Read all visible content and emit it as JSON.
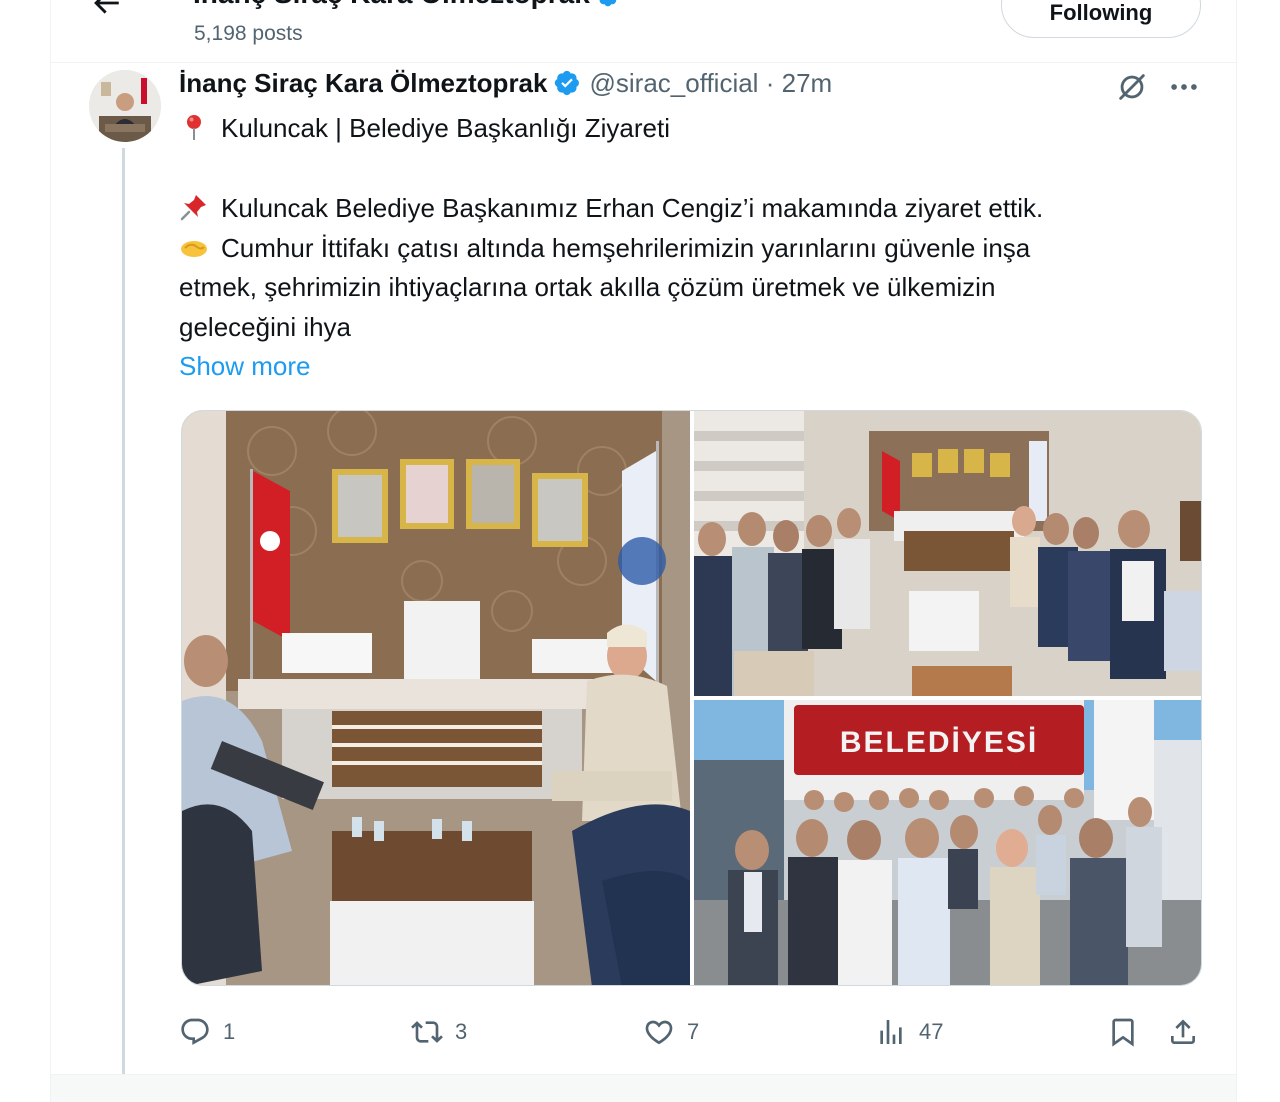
{
  "header": {
    "title": "İnanç Siraç Kara Ölmeztoprak",
    "post_count": "5,198 posts",
    "following_label": "Following"
  },
  "tweet": {
    "display_name": "İnanç Siraç Kara Ölmeztoprak",
    "handle": "@sirac_official",
    "separator": "·",
    "time": "27m",
    "lines": [
      "Kuluncak | Belediye Başkanlığı Ziyareti",
      "Kuluncak Belediye Başkanımız Erhan Cengiz’i makamında ziyaret ettik.",
      "Cumhur İttifakı çatısı altında hemşehrilerimizin yarınlarını güvenle inşa",
      "etmek, şehrimizin ihtiyaçlarına ortak akılla çözüm üretmek ve ülkemizin",
      "geleceğini ihya"
    ],
    "show_more": "Show more",
    "media_text": "BELEDİYESİ",
    "stats": {
      "replies": "1",
      "reposts": "3",
      "likes": "7",
      "views": "47"
    }
  },
  "icons": {
    "back": "back-arrow-icon",
    "verified": "verified-badge-icon",
    "grok": "grok-icon",
    "more": "more-icon",
    "pin": "round-pushpin-emoji",
    "pushpin": "pushpin-emoji",
    "handshake": "handshake-emoji",
    "reply": "reply-icon",
    "repost": "repost-icon",
    "like": "heart-icon",
    "views": "views-icon",
    "bookmark": "bookmark-icon",
    "share": "share-icon"
  },
  "colors": {
    "accent": "#1d9bf0",
    "text": "#0f1419",
    "secondary": "#536471"
  }
}
